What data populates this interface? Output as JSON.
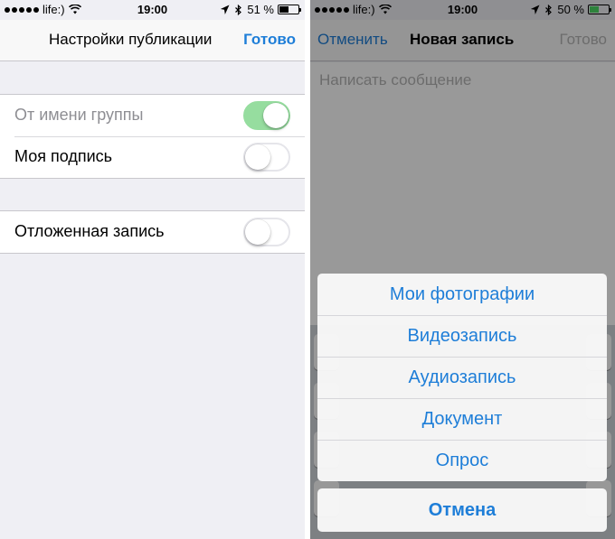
{
  "left": {
    "status": {
      "carrier": "life:)",
      "time": "19:00",
      "battery_text": "51 %",
      "battery_level": 0.51
    },
    "nav": {
      "title": "Настройки публикации",
      "done": "Готово"
    },
    "rows": [
      {
        "label": "От имени группы",
        "on": true,
        "disabled": true
      },
      {
        "label": "Моя подпись",
        "on": false,
        "disabled": false
      },
      {
        "label": "Отложенная запись",
        "on": false,
        "disabled": false
      }
    ]
  },
  "right": {
    "status": {
      "carrier": "life:)",
      "time": "19:00",
      "battery_text": "50 %",
      "battery_level": 0.5
    },
    "nav": {
      "cancel": "Отменить",
      "title": "Новая запись",
      "done": "Готово"
    },
    "compose": {
      "placeholder": "Написать сообщение"
    },
    "sheet": {
      "options": [
        "Мои фотографии",
        "Видеозапись",
        "Аудиозапись",
        "Документ",
        "Опрос"
      ],
      "cancel": "Отмена"
    }
  },
  "colors": {
    "accent": "#1e7ed8",
    "toggle_on": "#96dd9f",
    "battery_green": "#4cd964"
  },
  "icons": [
    "signal-dots-icon",
    "wifi-icon",
    "location-arrow-icon",
    "bluetooth-icon",
    "battery-icon"
  ]
}
